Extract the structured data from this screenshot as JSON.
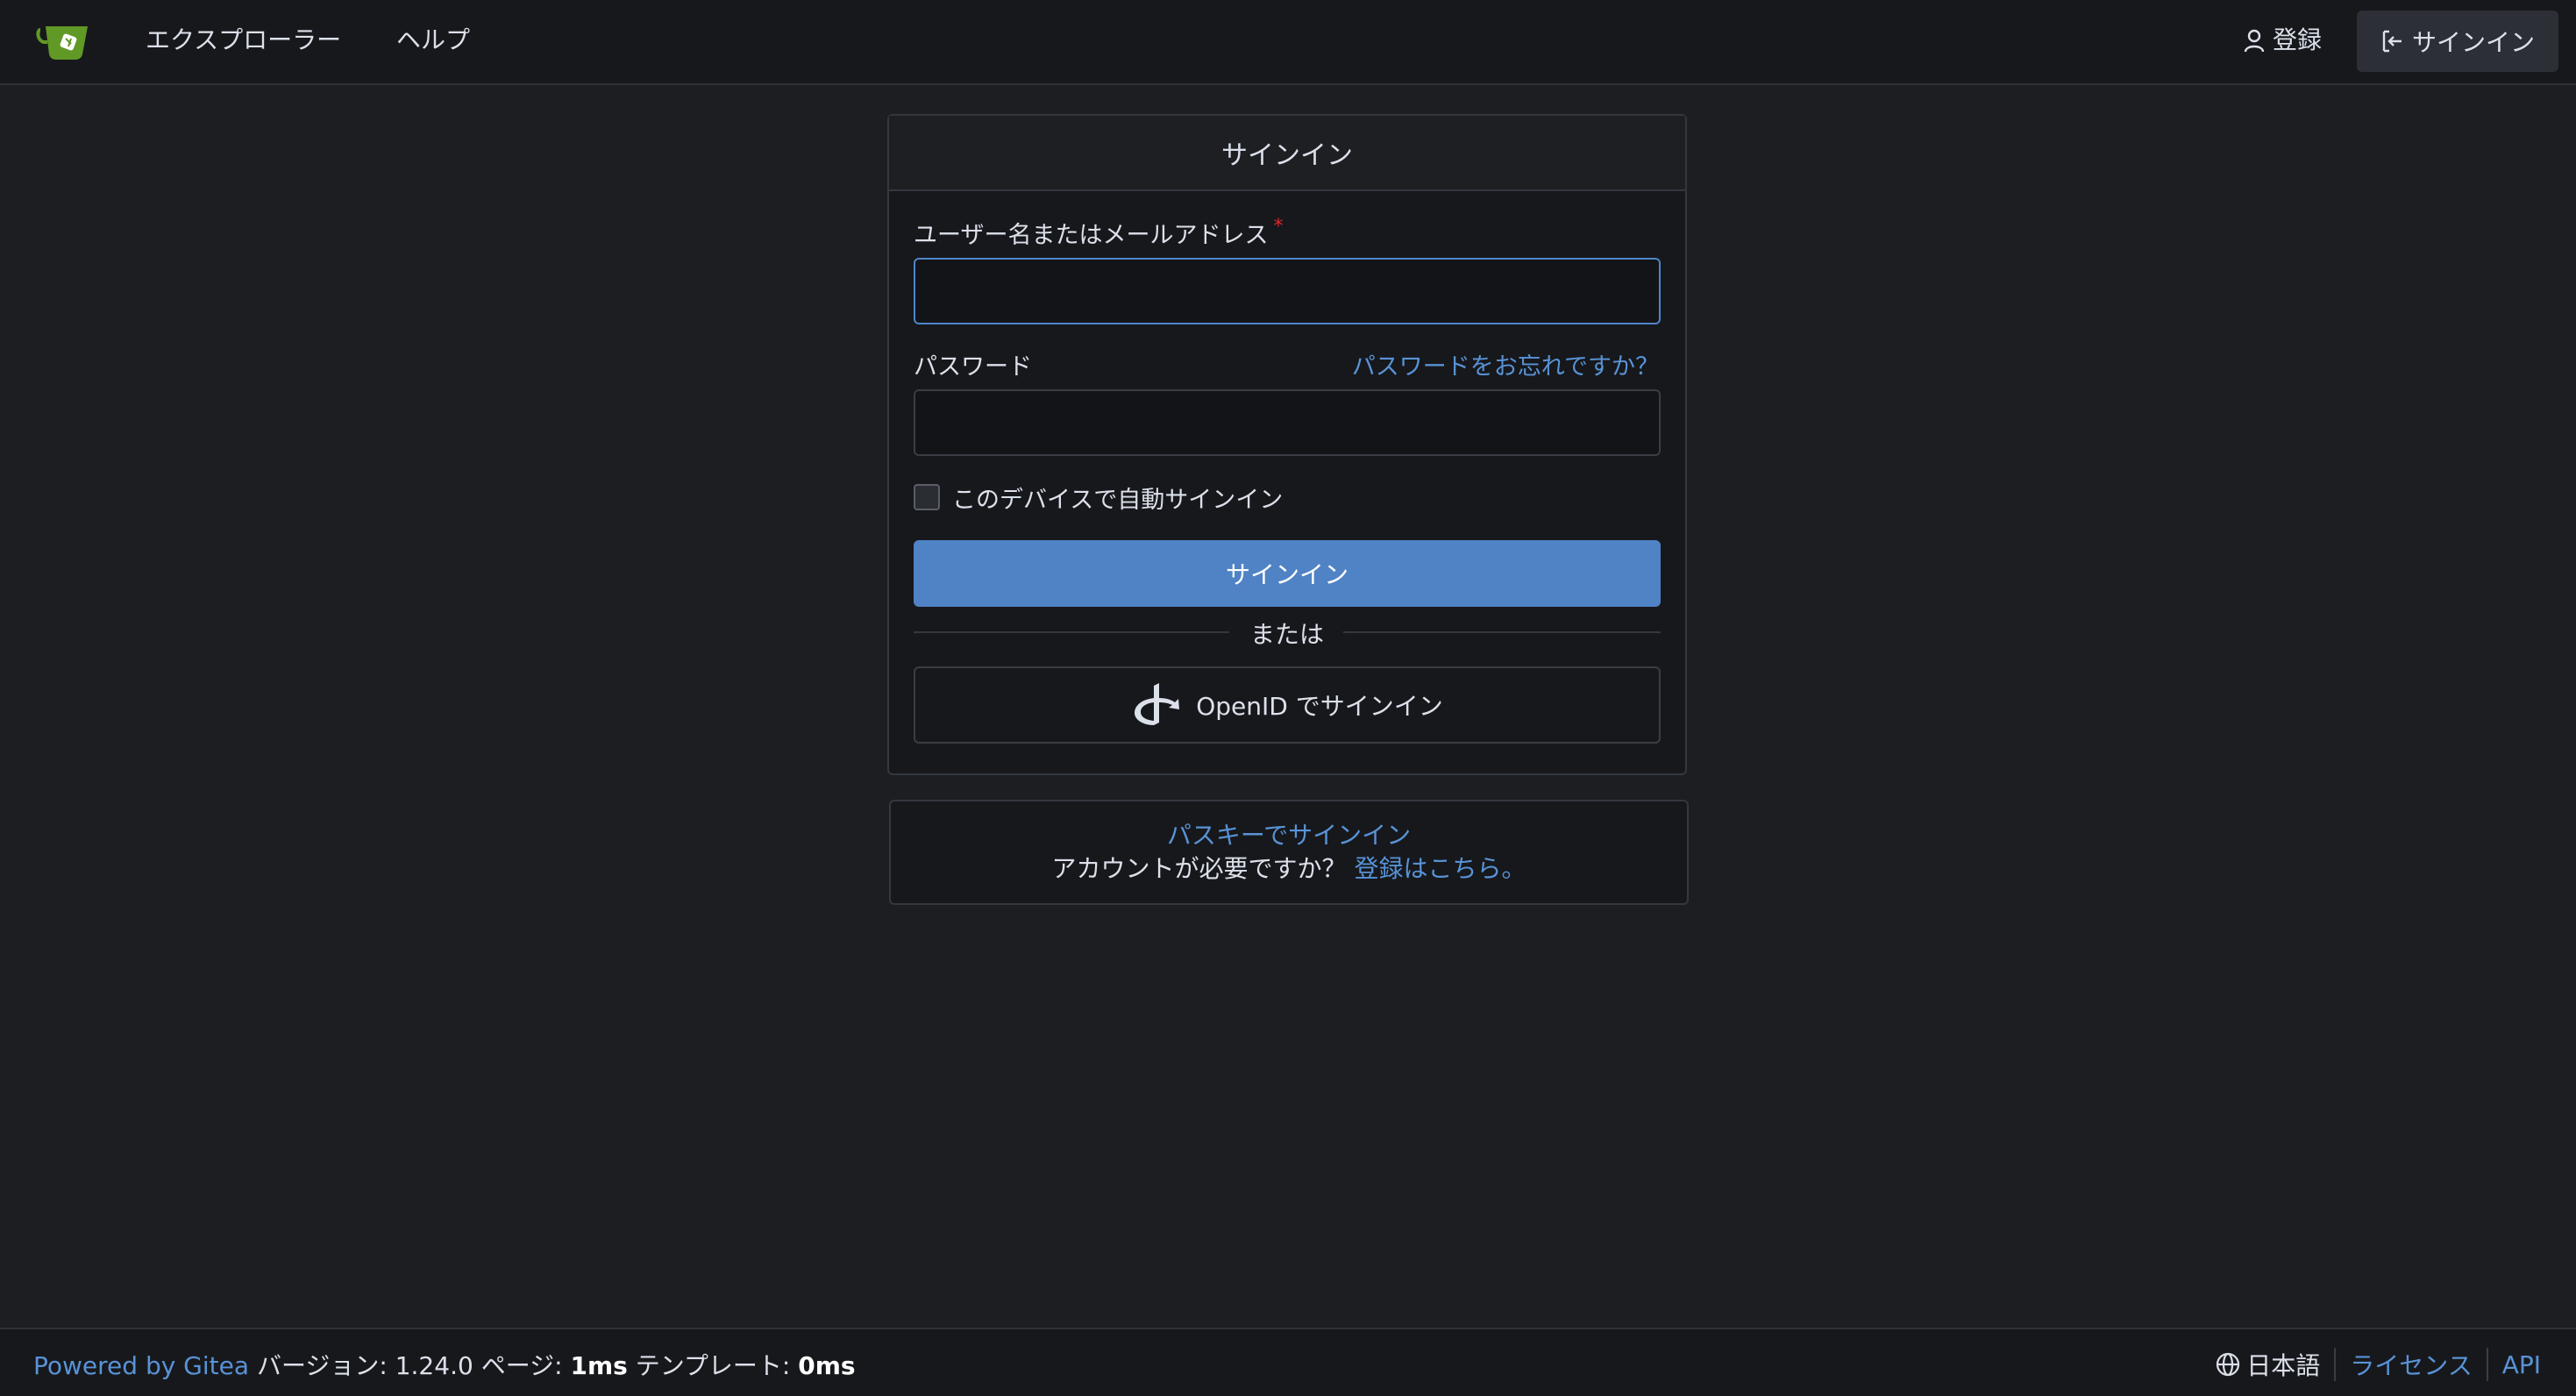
{
  "nav": {
    "links": [
      "エクスプローラー",
      "ヘルプ"
    ],
    "register": "登録",
    "signin": "サインイン"
  },
  "signin_card": {
    "title": "サインイン",
    "username_label": "ユーザー名またはメールアドレス",
    "required_mark": "*",
    "username_value": "",
    "password_label": "パスワード",
    "forgot_link": "パスワードをお忘れですか？",
    "password_value": "",
    "remember_label": "このデバイスで自動サインイン",
    "remember_checked": false,
    "submit_label": "サインイン",
    "divider_text": "または",
    "openid_label": "OpenID でサインイン"
  },
  "alt_card": {
    "passkey_link": "パスキーでサインイン",
    "need_account": "アカウントが必要ですか？",
    "register_link": "登録はこちら。"
  },
  "footer": {
    "powered_by": "Powered by Gitea",
    "version_label": "バージョン:",
    "version": "1.24.0",
    "page_label": "ページ:",
    "page_time": "1ms",
    "template_label": "テンプレート:",
    "template_time": "0ms",
    "language": "日本語",
    "license": "ライセンス",
    "api": "API"
  },
  "colors": {
    "accent": "#4f83c5",
    "link": "#5893d6",
    "logo_green": "#609926",
    "background": "#1c1e22"
  }
}
